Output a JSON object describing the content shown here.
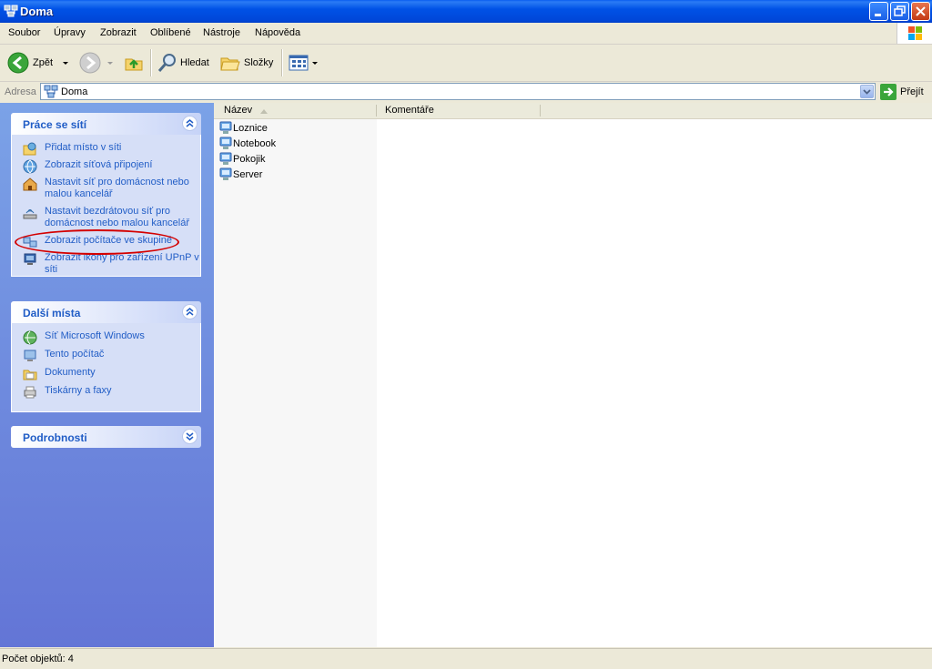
{
  "window": {
    "title": "Doma"
  },
  "menu": [
    "Soubor",
    "Úpravy",
    "Zobrazit",
    "Oblíbené",
    "Nástroje",
    "Nápověda"
  ],
  "toolbar": {
    "back": "Zpět",
    "search": "Hledat",
    "folders": "Složky"
  },
  "address": {
    "label": "Adresa",
    "value": "Doma",
    "go": "Přejít"
  },
  "panels": {
    "network_tasks": {
      "title": "Práce se sítí",
      "items": [
        "Přidat místo v síti",
        "Zobrazit síťová připojení",
        "Nastavit síť pro domácnost nebo malou kancelář",
        "Nastavit bezdrátovou síť pro domácnost nebo malou kancelář",
        "Zobrazit počítače ve skupině",
        "Zobrazit ikony pro zařízení UPnP v síti"
      ]
    },
    "other_places": {
      "title": "Další místa",
      "items": [
        "Síť Microsoft Windows",
        "Tento počítač",
        "Dokumenty",
        "Tiskárny a faxy"
      ]
    },
    "details": {
      "title": "Podrobnosti"
    }
  },
  "list": {
    "columns": [
      "Název",
      "Komentáře"
    ],
    "items": [
      "Loznice",
      "Notebook",
      "Pokojik",
      "Server"
    ]
  },
  "status": {
    "text": "Počet objektů: 4"
  },
  "colors": {
    "accent_title": "#0054e3",
    "task_link": "#215dc6",
    "highlight": "#d40000"
  }
}
